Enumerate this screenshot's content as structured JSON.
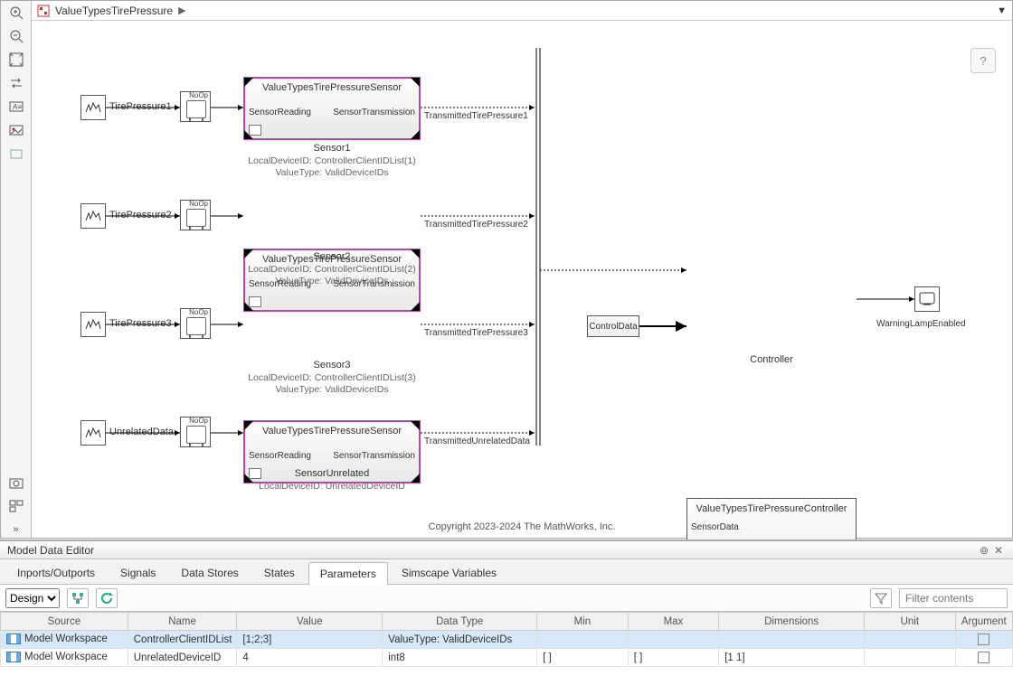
{
  "breadcrumb": {
    "title": "ValueTypesTirePressure"
  },
  "help_label": "?",
  "copyright": "Copyright 2023-2024 The MathWorks, Inc.",
  "sources": {
    "tp1": "TirePressure1",
    "tp2": "TirePressure2",
    "tp3": "TirePressure3",
    "unrel": "UnrelatedData"
  },
  "noop": "NoOp",
  "sensor_block": {
    "title": "ValueTypesTirePressureSensor",
    "in": "SensorReading",
    "out": "SensorTransmission"
  },
  "sensors": {
    "s1": {
      "name": "Sensor1",
      "sub1": "LocalDeviceID: ControllerClientIDList(1)",
      "sub2": "ValueType: ValidDeviceIDs"
    },
    "s2": {
      "name": "Sensor2",
      "sub1": "LocalDeviceID: ControllerClientIDList(2)",
      "sub2": "ValueType: ValidDeviceIDs"
    },
    "s3": {
      "name": "Sensor3",
      "sub1": "LocalDeviceID: ControllerClientIDList(3)",
      "sub2": "ValueType: ValidDeviceIDs"
    },
    "su": {
      "name": "SensorUnrelated",
      "sub1": "LocalDeviceID: UnrelatedDeviceID"
    }
  },
  "wirelabels": {
    "t1": "TransmittedTirePressure1",
    "t2": "TransmittedTirePressure2",
    "t3": "TransmittedTirePressure3",
    "tu": "TransmittedUnrelatedData"
  },
  "controller": {
    "title": "ValueTypesTirePressureController",
    "in1": "SensorData",
    "in2": "ControlData",
    "out": "WarningLampEnabled",
    "name": "Controller"
  },
  "controldata": "ControlData",
  "scope_label": "WarningLampEnabled",
  "mde": {
    "title": "Model Data Editor",
    "tabs": [
      "Inports/Outports",
      "Signals",
      "Data Stores",
      "States",
      "Parameters",
      "Simscape Variables"
    ],
    "active_tab": "Parameters",
    "design": "Design",
    "filter_placeholder": "Filter contents",
    "columns": [
      "Source",
      "Name",
      "Value",
      "Data Type",
      "Min",
      "Max",
      "Dimensions",
      "Unit",
      "Argument"
    ],
    "rows": [
      {
        "source": "Model Workspace",
        "name": "ControllerClientIDList",
        "value": "[1;2;3]",
        "datatype": "ValueType: ValidDeviceIDs",
        "min": "",
        "max": "",
        "dims": "",
        "unit": "",
        "arg": false
      },
      {
        "source": "Model Workspace",
        "name": "UnrelatedDeviceID",
        "value": "4",
        "datatype": "int8",
        "min": "[ ]",
        "max": "[ ]",
        "dims": "[1 1]",
        "unit": "",
        "arg": false
      }
    ]
  }
}
